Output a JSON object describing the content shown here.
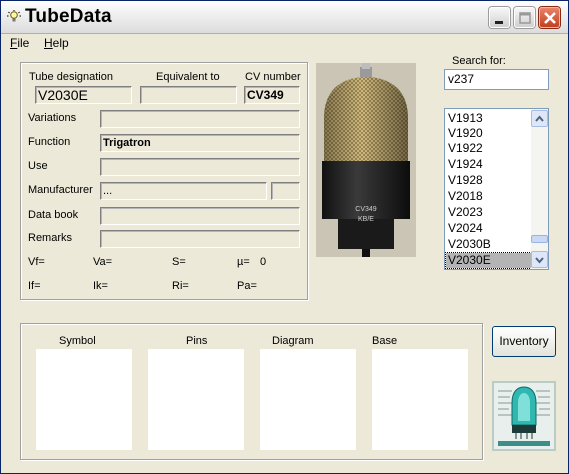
{
  "app": {
    "title": "TubeData"
  },
  "menu": {
    "items": [
      {
        "underline": "F",
        "rest": "ile"
      },
      {
        "underline": "H",
        "rest": "elp"
      }
    ]
  },
  "details": {
    "tube_designation_label": "Tube designation",
    "tube_designation": "V2030E",
    "equivalent_label": "Equivalent to",
    "equivalent": "",
    "cv_number_label": "CV number",
    "cv_number": "CV349",
    "variations_label": "Variations",
    "variations": "",
    "function_label": "Function",
    "function": "Trigatron",
    "use_label": "Use",
    "use": "",
    "manufacturer_label": "Manufacturer",
    "manufacturer": "...",
    "data_book_label": "Data book",
    "data_book": "",
    "remarks_label": "Remarks",
    "remarks": "",
    "vf": "Vf=",
    "va": "Va=",
    "s": "S=",
    "mu": "µ=",
    "mu_value": "0",
    "if": "If=",
    "ik": "Ik=",
    "ri": "Ri=",
    "pa": "Pa="
  },
  "search": {
    "label": "Search for:",
    "value": "v237",
    "results": [
      "V1913",
      "V1920",
      "V1922",
      "V1924",
      "V1928",
      "V2018",
      "V2023",
      "V2024",
      "V2030B",
      "V2030E"
    ],
    "selected": "V2030E"
  },
  "photo": {
    "tube_markings": [
      "CV349",
      "KB/E"
    ]
  },
  "bottom": {
    "symbol_label": "Symbol",
    "pins_label": "Pins",
    "diagram_label": "Diagram",
    "base_label": "Base",
    "inventory_button": "Inventory"
  },
  "icons": {
    "app": "lightbulb-icon",
    "minimize": "minimize-icon",
    "maximize": "maximize-icon",
    "close": "close-icon",
    "scroll_up": "arrow-up-icon",
    "scroll_down": "arrow-down-icon",
    "logo": "tube-logo-icon"
  },
  "colors": {
    "close_button": "#c3401e",
    "selection": "#b4b4b4",
    "window_bg": "#ece9d8"
  }
}
